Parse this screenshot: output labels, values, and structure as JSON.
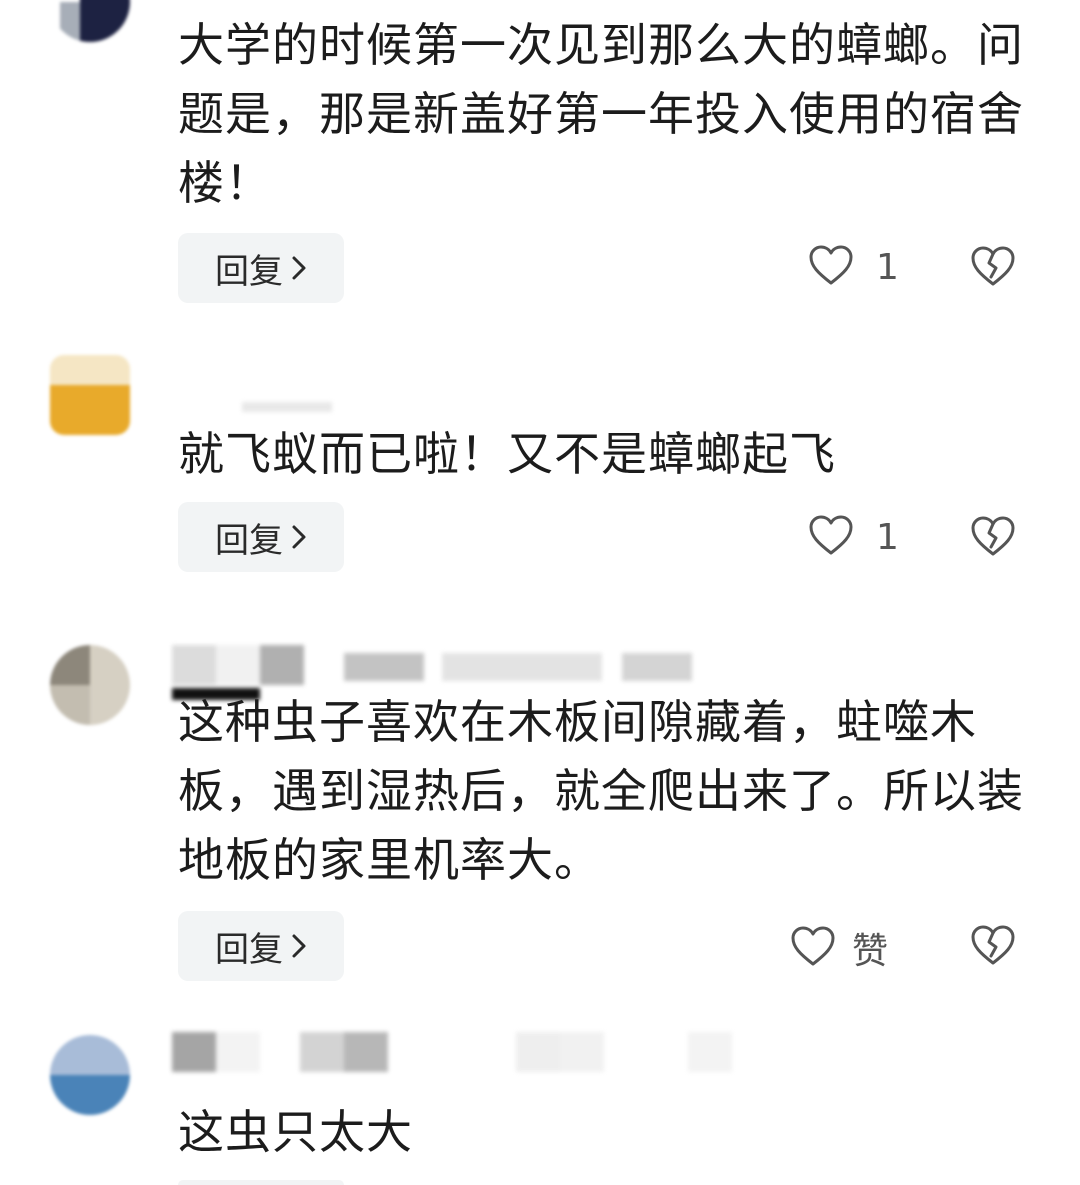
{
  "comments": [
    {
      "text": "大学的时候第一次见到那么大的蟑螂。问题是，那是新盖好第一年投入使用的宿舍楼！",
      "reply_label": "回复",
      "like_count": "1"
    },
    {
      "text": "就飞蚁而已啦！又不是蟑螂起飞",
      "reply_label": "回复",
      "like_count": "1"
    },
    {
      "text": "这种虫子喜欢在木板间隙藏着，蛀噬木板，遇到湿热后，就全爬出来了。所以装地板的家里机率大。",
      "reply_label": "回复",
      "like_count": "赞"
    },
    {
      "text": "这虫只太大"
    }
  ],
  "icons": {
    "like": "heart-outline-icon",
    "dislike": "broken-heart-icon",
    "chevron": "chevron-right-icon"
  },
  "colors": {
    "text": "#1c1c1c",
    "reply_bg": "#f2f4f5",
    "icon": "#555555"
  }
}
